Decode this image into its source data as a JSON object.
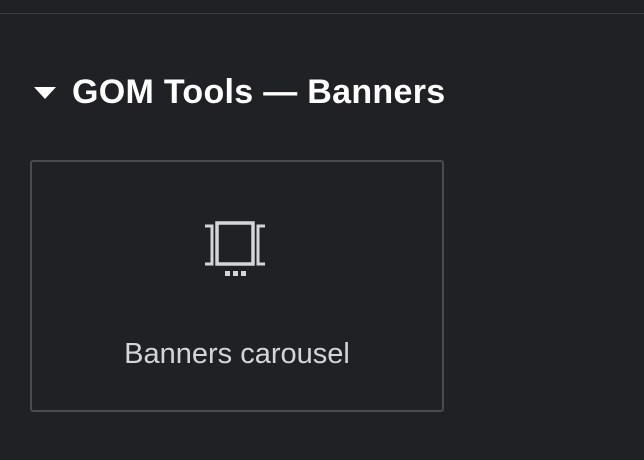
{
  "section": {
    "title": "GOM Tools — Banners",
    "expanded": true
  },
  "widgets": [
    {
      "label": "Banners carousel",
      "icon": "carousel-icon"
    }
  ],
  "colors": {
    "background": "#202124",
    "text_primary": "#ffffff",
    "text_secondary": "#d4d5d8",
    "card_border": "#4a4b50"
  }
}
